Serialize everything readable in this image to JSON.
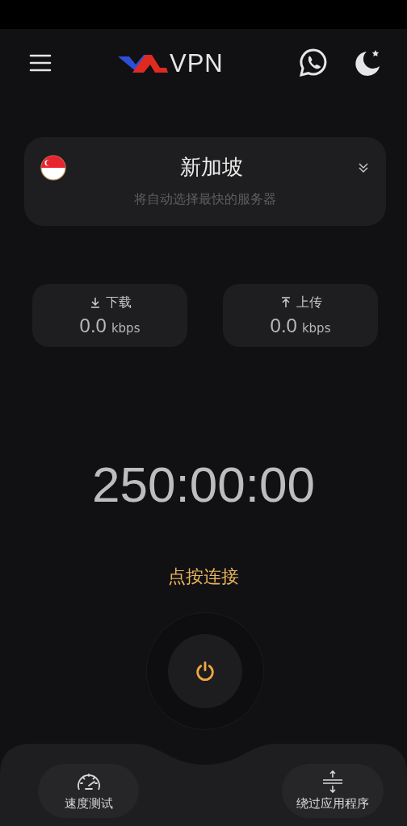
{
  "header": {
    "app_name": "VPN"
  },
  "server": {
    "name": "新加坡",
    "subtitle": "将自动选择最快的服务器"
  },
  "stats": [
    {
      "kind": "download",
      "label": "下载",
      "value": "0.0",
      "unit": "kbps"
    },
    {
      "kind": "upload",
      "label": "上传",
      "value": "0.0",
      "unit": "kbps"
    }
  ],
  "timer": "250:00:00",
  "connect_label": "点按连接",
  "bottom_actions": [
    {
      "kind": "speed",
      "label": "速度测试"
    },
    {
      "kind": "bypass",
      "label": "绕过应用程序"
    }
  ]
}
